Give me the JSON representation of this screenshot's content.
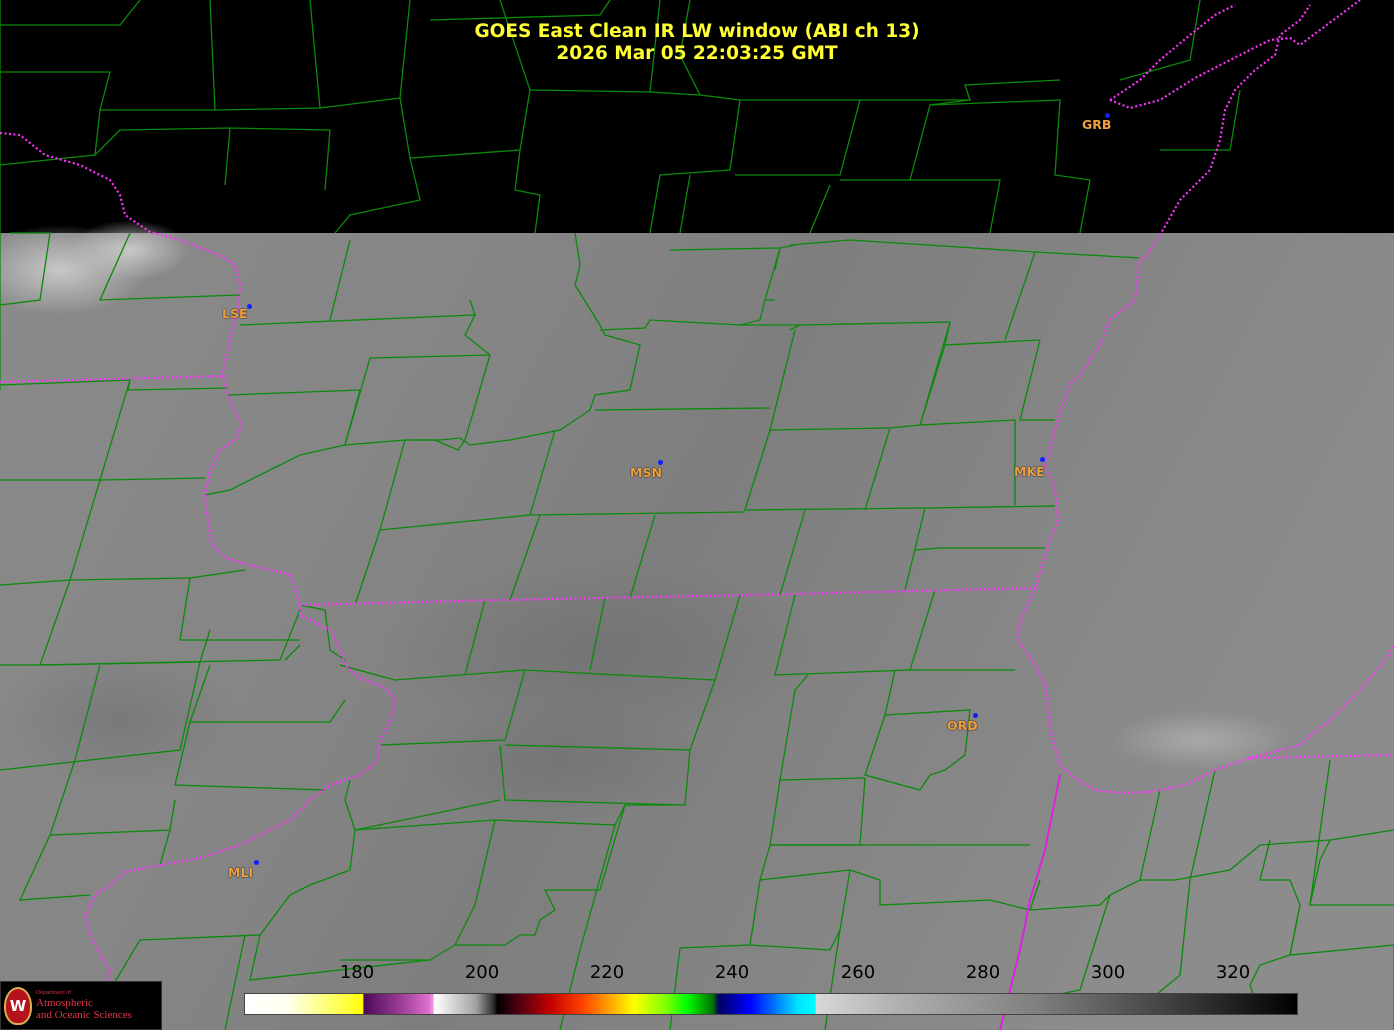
{
  "title": {
    "line1": "GOES East Clean IR LW window (ABI ch 13)",
    "line2": "2026 Mar 05  22:03:25 GMT"
  },
  "colors": {
    "title": "#ffff33",
    "county_lines": "#0a8a0a",
    "state_lines": "#ff33ff",
    "station_label": "#f0a040",
    "station_dot": "#1020ff",
    "no_data": "#000000"
  },
  "stations": [
    {
      "id": "GRB",
      "label": "GRB"
    },
    {
      "id": "LSE",
      "label": "LSE"
    },
    {
      "id": "MSN",
      "label": "MSN"
    },
    {
      "id": "MKE",
      "label": "MKE"
    },
    {
      "id": "ORD",
      "label": "ORD"
    },
    {
      "id": "MLI",
      "label": "MLI"
    }
  ],
  "colorbar": {
    "units": "",
    "ticks": [
      "180",
      "200",
      "220",
      "240",
      "260",
      "280",
      "300",
      "320"
    ]
  },
  "logo": {
    "line_small": "Department of",
    "line1": "Atmospheric",
    "line2": "and Oceanic Sciences",
    "seal_letter": "W"
  }
}
